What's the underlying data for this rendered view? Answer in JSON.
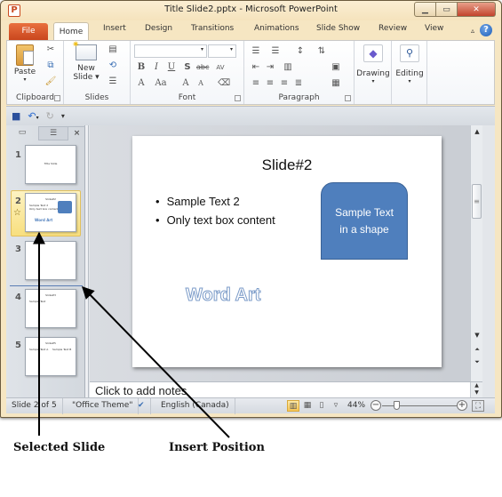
{
  "window": {
    "title": "Title Slide2.pptx  -  Microsoft PowerPoint",
    "app_icon": "P",
    "controls": {
      "minimize": "minimize-icon",
      "maximize": "maximize-icon",
      "close": "close-icon"
    }
  },
  "ribbon_tabs": {
    "file": "File",
    "home": "Home",
    "others": [
      "Insert",
      "Design",
      "Transitions",
      "Animations",
      "Slide Show",
      "Review",
      "View"
    ],
    "active": "Home"
  },
  "ribbon": {
    "clipboard": {
      "label": "Clipboard",
      "paste": "Paste"
    },
    "slides": {
      "label": "Slides",
      "new_slide_line1": "New",
      "new_slide_line2": "Slide ▾"
    },
    "font": {
      "label": "Font",
      "bold": "B",
      "italic": "I",
      "underline": "U",
      "shadow": "S",
      "strike": "abc",
      "spacing": "AV",
      "grow": "A",
      "shrink": "A",
      "case": "Aa",
      "clear": "A"
    },
    "paragraph": {
      "label": "Paragraph"
    },
    "drawing": {
      "label": "Drawing"
    },
    "editing": {
      "label": "Editing"
    }
  },
  "quick_access": [
    "save-icon",
    "undo-icon",
    "redo-icon",
    "customize-icon"
  ],
  "thumb_pane": {
    "tabs": {
      "slides": "slides-tab-icon",
      "outline": "outline-tab-icon",
      "close": "×"
    },
    "slides": [
      {
        "num": "1",
        "title": "Title Slide",
        "lines": []
      },
      {
        "num": "2",
        "title": "Slide#2",
        "lines": [
          "Sample Text 2",
          "Only text box content"
        ],
        "selected": true
      },
      {
        "num": "3",
        "title": "",
        "lines": []
      },
      {
        "num": "4",
        "title": "Slide#3",
        "lines": [
          "Sample Text"
        ]
      },
      {
        "num": "5",
        "title": "Slide#5",
        "lines": [
          "Sample Text A",
          "Sample Text B"
        ]
      }
    ],
    "transition_marker": "☆"
  },
  "slide": {
    "title": "Slide#2",
    "bullets": [
      "Sample Text 2",
      "Only text box content"
    ],
    "shape_text_line1": "Sample Text",
    "shape_text_line2": "in a shape",
    "wordart": "Word Art",
    "shape_color": "#4f7fbd"
  },
  "notes": {
    "placeholder": "Click to add notes"
  },
  "status": {
    "slide_pos": "Slide 2 of 5",
    "theme": "\"Office Theme\"",
    "language": "English (Canada)",
    "zoom": "44%",
    "zoom_percent": 44
  },
  "annotations": {
    "selected_slide": "Selected Slide",
    "insert_position": "Insert Position"
  }
}
